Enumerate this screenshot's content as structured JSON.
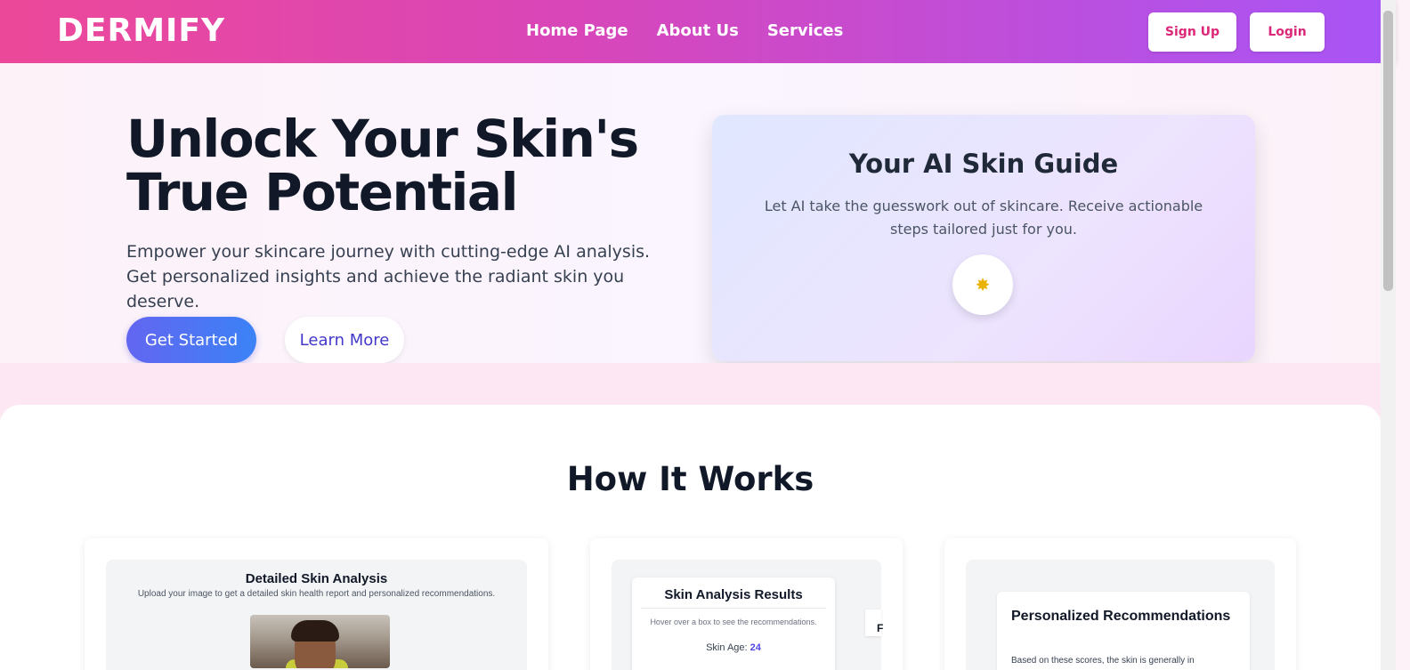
{
  "nav": {
    "logo": "DERMIFY",
    "links": [
      "Home Page",
      "About Us",
      "Services"
    ],
    "signup": "Sign Up",
    "login": "Login",
    "colors": {
      "gradient_start": "#ec4899",
      "gradient_end": "#a855f7"
    }
  },
  "hero": {
    "title": "Unlock Your Skin's True Potential",
    "subtitle": "Empower your skincare journey with cutting-edge AI analysis. Get personalized insights and achieve the radiant skin you deserve.",
    "get_started": "Get Started",
    "learn_more": "Learn More"
  },
  "guide": {
    "title": "Your AI Skin Guide",
    "text": "Let AI take the guesswork out of skincare. Receive actionable steps tailored just for you.",
    "icon": "sparkle-icon",
    "icon_glyph": "✸"
  },
  "how": {
    "title": "How It Works",
    "card1": {
      "title": "Detailed Skin Analysis",
      "subtitle": "Upload your image to get a detailed skin health report and personalized recommendations."
    },
    "card2": {
      "title": "Skin Analysis Results",
      "hover_text": "Hover over a box to see the recommendations.",
      "age_label": "Skin Age:",
      "age_value": "24",
      "side_letter": "F"
    },
    "card3": {
      "title": "Personalized Recommendations",
      "text": "Based on these scores, the skin is generally in"
    }
  }
}
